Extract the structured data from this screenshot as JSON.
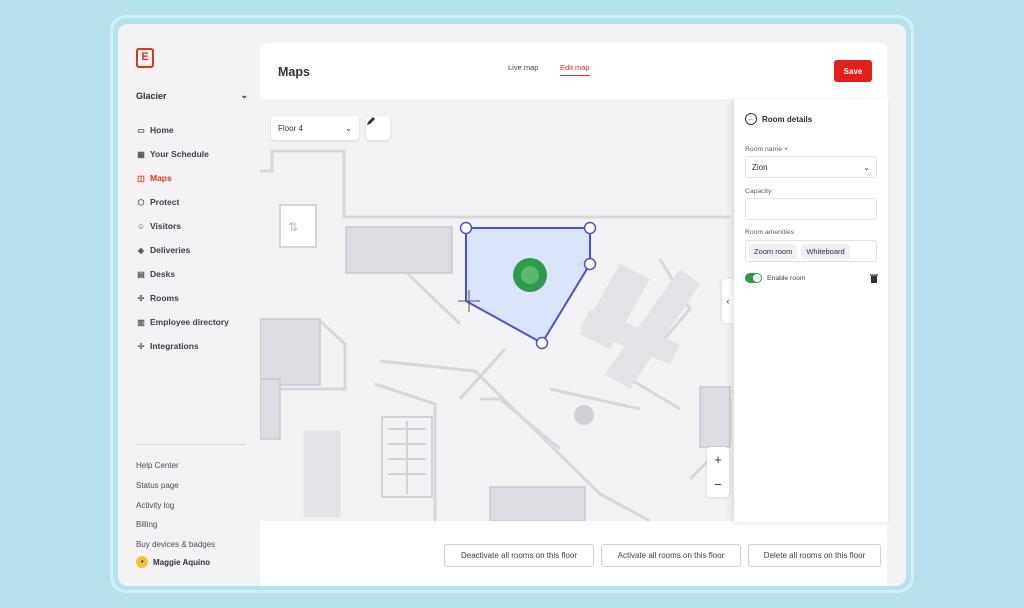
{
  "sidebar": {
    "logo": "E",
    "workspace": "Glacier",
    "items": [
      {
        "label": "Home",
        "icon": "home-icon"
      },
      {
        "label": "Your Schedule",
        "icon": "calendar-icon"
      },
      {
        "label": "Maps",
        "icon": "map-icon",
        "active": true
      },
      {
        "label": "Protect",
        "icon": "shield-icon"
      },
      {
        "label": "Visitors",
        "icon": "visitors-icon"
      },
      {
        "label": "Deliveries",
        "icon": "package-icon"
      },
      {
        "label": "Desks",
        "icon": "desk-icon"
      },
      {
        "label": "Rooms",
        "icon": "rooms-icon"
      },
      {
        "label": "Employee directory",
        "icon": "directory-icon"
      },
      {
        "label": "Integrations",
        "icon": "integrations-icon"
      }
    ],
    "links": [
      "Help Center",
      "Status page",
      "Activity log",
      "Billing",
      "Buy devices & badges"
    ],
    "user": {
      "name": "Maggie Aquino"
    }
  },
  "header": {
    "title": "Maps",
    "tabs": [
      {
        "label": "Live map"
      },
      {
        "label": "Edit map",
        "active": true
      }
    ],
    "save_label": "Save"
  },
  "map": {
    "floor": "Floor 4",
    "zoom_in": "+",
    "zoom_out": "−"
  },
  "panel": {
    "title": "Room details",
    "room_name_label": "Room name",
    "room_name_value": "Zion",
    "capacity_label": "Capacity",
    "capacity_value": "",
    "amenities_label": "Room amenities",
    "amenities": [
      "Zoom room",
      "Whiteboard"
    ],
    "enable_label": "Enable room"
  },
  "footer": {
    "deactivate_label": "Deactivate all rooms on this floor",
    "activate_label": "Activate all rooms on this floor",
    "delete_label": "Delete all rooms on this floor"
  },
  "colors": {
    "accent": "#e0321f",
    "polygon": "#4c4fd2",
    "room_pin": "#2f9a4a"
  }
}
